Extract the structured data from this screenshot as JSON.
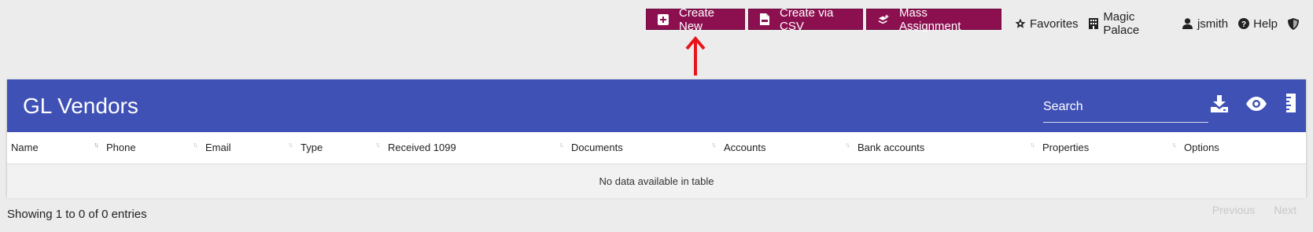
{
  "toolbar": {
    "create_new": "Create New",
    "create_csv": "Create via CSV",
    "mass_assignment": "Mass Assignment"
  },
  "topnav": {
    "favorites": "Favorites",
    "property": "Magic Palace",
    "user": "jsmith",
    "help": "Help"
  },
  "card": {
    "title": "GL Vendors",
    "search_placeholder": "Search"
  },
  "table": {
    "columns": [
      "Name",
      "Phone",
      "Email",
      "Type",
      "Received 1099",
      "Documents",
      "Accounts",
      "Bank accounts",
      "Properties",
      "Options"
    ],
    "empty_message": "No data available in table"
  },
  "footer": {
    "info": "Showing 1 to 0 of 0 entries",
    "previous": "Previous",
    "next": "Next"
  },
  "colors": {
    "button": "#8c0f50",
    "header": "#3f51b5",
    "arrow": "#e8141b"
  }
}
